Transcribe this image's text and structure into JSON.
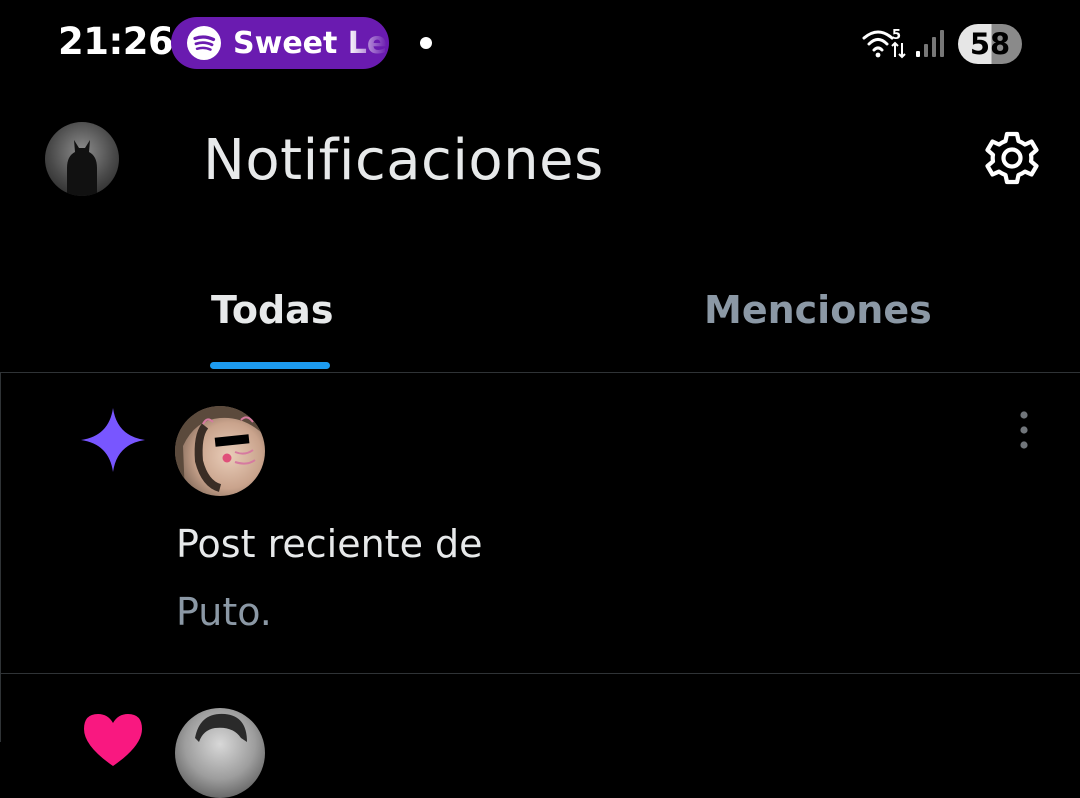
{
  "status_bar": {
    "time": "21:26",
    "media_text": "Sweet Le",
    "wifi_label": "5",
    "battery": "58"
  },
  "header": {
    "title": "Notificaciones"
  },
  "tabs": [
    {
      "label": "Todas",
      "active": true
    },
    {
      "label": "Menciones",
      "active": false
    }
  ],
  "notifications": [
    {
      "icon": "sparkle-icon",
      "text": "Post reciente de",
      "subtext": "Puto."
    },
    {
      "icon": "heart-icon"
    }
  ],
  "colors": {
    "accent": "#1d9bf0",
    "sparkle": "#7856ff",
    "heart": "#f91880",
    "spotify_pill": "#6a1bb0"
  }
}
